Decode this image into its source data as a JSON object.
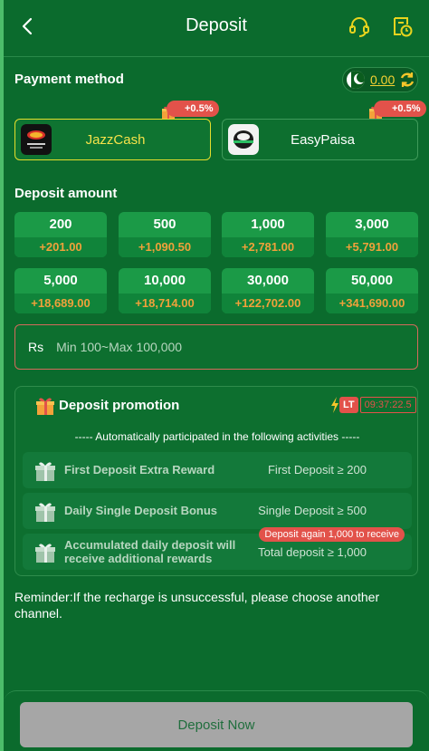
{
  "header": {
    "title": "Deposit",
    "back_icon": "chevron-left-icon",
    "support_icon": "headset-icon",
    "history_icon": "clock-document-icon"
  },
  "payment": {
    "section_title": "Payment method",
    "balance": "0.00",
    "methods": [
      {
        "label": "JazzCash",
        "bonus": "+0.5%",
        "selected": true
      },
      {
        "label": "EasyPaisa",
        "bonus": "+0.5%",
        "selected": false
      }
    ]
  },
  "amount": {
    "section_title": "Deposit amount",
    "options": [
      {
        "value": "200",
        "bonus": "+201.00"
      },
      {
        "value": "500",
        "bonus": "+1,090.50"
      },
      {
        "value": "1,000",
        "bonus": "+2,781.00"
      },
      {
        "value": "3,000",
        "bonus": "+5,791.00"
      },
      {
        "value": "5,000",
        "bonus": "+18,689.00"
      },
      {
        "value": "10,000",
        "bonus": "+18,714.00"
      },
      {
        "value": "30,000",
        "bonus": "+122,702.00"
      },
      {
        "value": "50,000",
        "bonus": "+341,690.00"
      }
    ],
    "currency": "Rs",
    "placeholder": "Min 100~Max 100,000"
  },
  "promotion": {
    "title": "Deposit promotion",
    "badge": "LT",
    "timer": "09:37:22.5",
    "subtitle": "----- Automatically participated in the following activities -----",
    "rows": [
      {
        "name": "First Deposit Extra Reward",
        "condition": "First Deposit ≥ 200"
      },
      {
        "name": "Daily Single Deposit Bonus",
        "condition": "Single Deposit ≥ 500"
      },
      {
        "name": "Accumulated daily deposit will receive additional rewards",
        "condition": "Total deposit ≥ 1,000",
        "tag": "Deposit again 1,000 to receive"
      }
    ]
  },
  "reminder": "Reminder:If the recharge is unsuccessful, please choose another channel.",
  "footer": {
    "button": "Deposit Now"
  },
  "colors": {
    "background": "#0b6b2d",
    "accent_yellow": "#f6e24a",
    "bonus_orange": "#f0a13a",
    "tag_red": "#e2524a",
    "button_disabled": "#a6a6a6"
  }
}
